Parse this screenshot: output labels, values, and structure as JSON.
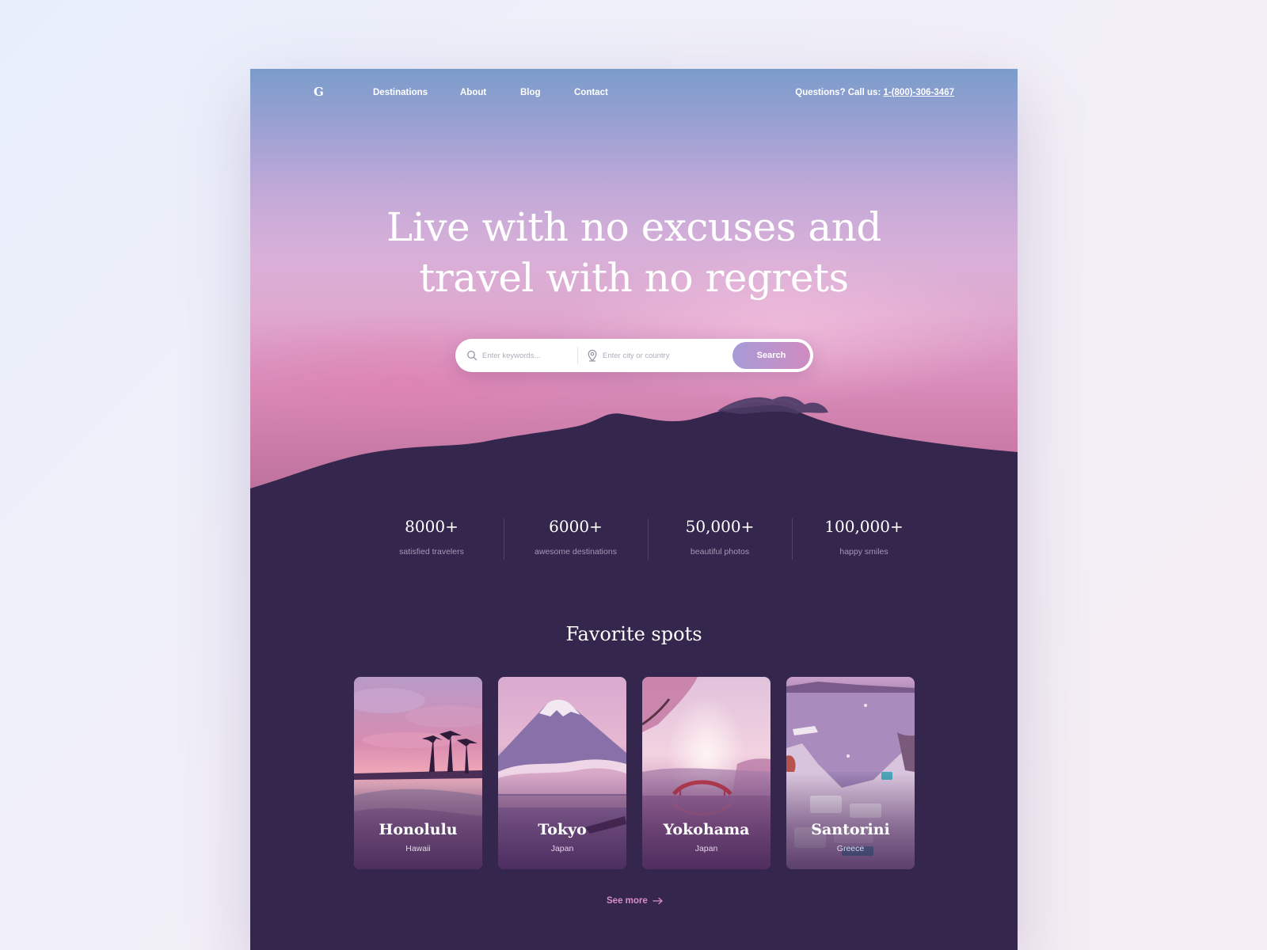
{
  "brand": {
    "logo": "G"
  },
  "nav": {
    "links": [
      "Destinations",
      "About",
      "Blog",
      "Contact"
    ],
    "questions_label": "Questions? Call us:",
    "phone": "1-(800)-306-3467"
  },
  "hero": {
    "headline_line1": "Live with no excuses and",
    "headline_line2": "travel with no regrets"
  },
  "search": {
    "keywords_placeholder": "Enter keywords...",
    "location_placeholder": "Enter city or country",
    "button_label": "Search"
  },
  "stats": [
    {
      "value": "8000+",
      "label": "satisfied travelers"
    },
    {
      "value": "6000+",
      "label": "awesome destinations"
    },
    {
      "value": "50,000+",
      "label": "beautiful photos"
    },
    {
      "value": "100,000+",
      "label": "happy smiles"
    }
  ],
  "favorites": {
    "title": "Favorite spots",
    "spots": [
      {
        "city": "Honolulu",
        "country": "Hawaii"
      },
      {
        "city": "Tokyo",
        "country": "Japan"
      },
      {
        "city": "Yokohama",
        "country": "Japan"
      },
      {
        "city": "Santorini",
        "country": "Greece"
      }
    ],
    "see_more": "See more"
  },
  "icons": [
    "search-icon",
    "location-pin-icon",
    "arrow-right-icon"
  ],
  "colors": {
    "page_bg": "#35264d",
    "accent_pink": "#d78ec6",
    "search_gradient_start": "#a79ad6",
    "search_gradient_end": "#d08cc0"
  }
}
